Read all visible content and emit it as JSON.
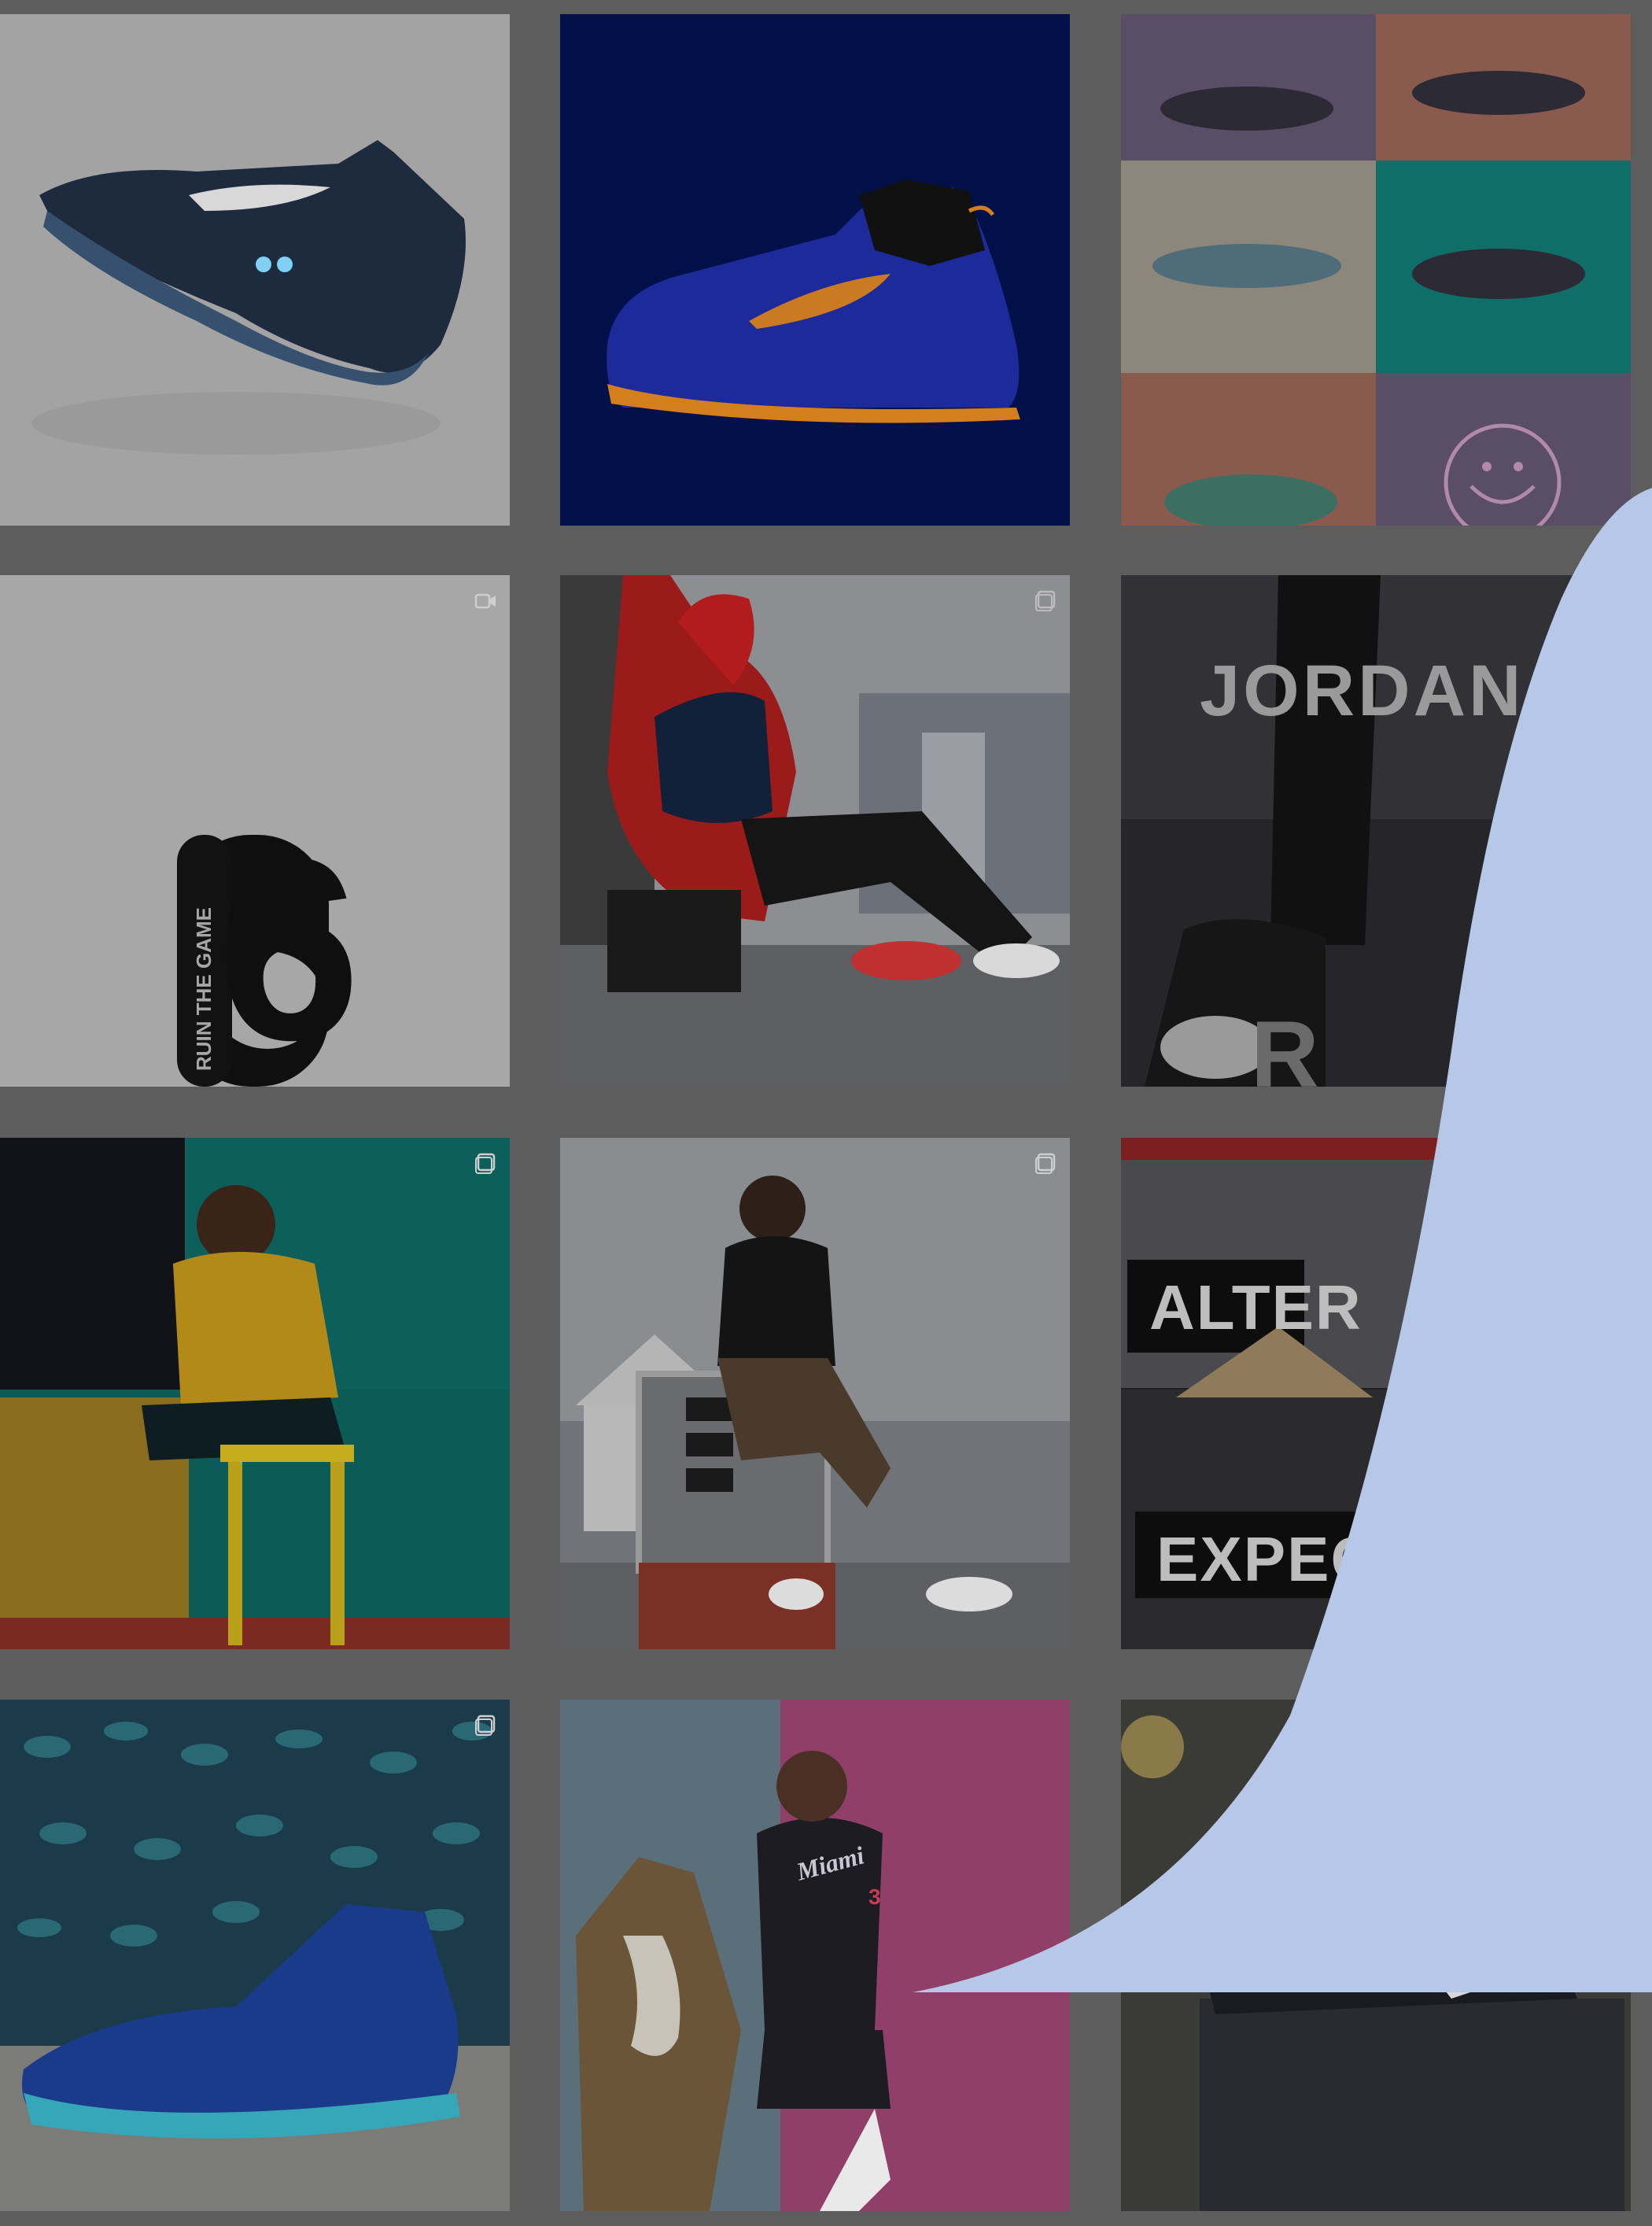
{
  "feed": {
    "tiles": [
      {
        "id": "t1",
        "caption": ""
      },
      {
        "id": "t2",
        "caption": ""
      },
      {
        "id": "t3",
        "caption": ""
      },
      {
        "id": "t4",
        "text_vertical": "RUIN THE GAME",
        "text_number": "6"
      },
      {
        "id": "t5",
        "caption": ""
      },
      {
        "id": "t6",
        "text_logo": "JORDAN",
        "text_bottom": "R"
      },
      {
        "id": "t7",
        "caption": ""
      },
      {
        "id": "t8",
        "caption": ""
      },
      {
        "id": "t9",
        "text_top": "ALTER",
        "text_bottom": "EXPECT"
      },
      {
        "id": "t10",
        "caption": ""
      },
      {
        "id": "t11",
        "jersey_text": "Miami",
        "jersey_number": "3"
      },
      {
        "id": "t12",
        "caption": ""
      }
    ]
  },
  "colors": {
    "page_bg": "#5d5d5d",
    "overlay_blob": "#b6c7e8",
    "tile_light": "#a7a7a7",
    "navy_tile": "#02104a",
    "teal": "#0f8a83"
  },
  "icons": {
    "video_badge": "video-icon",
    "carousel_badge": "carousel-icon"
  }
}
